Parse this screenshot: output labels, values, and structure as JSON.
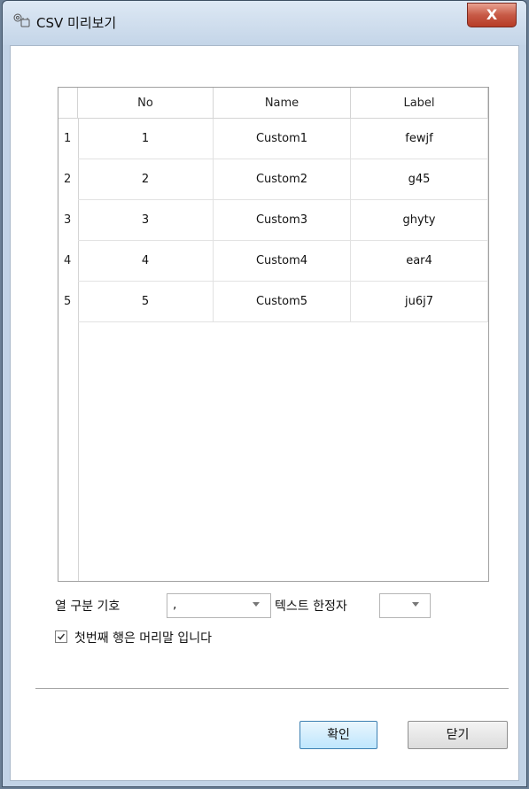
{
  "window": {
    "title": "CSV 미리보기",
    "close_label": "X"
  },
  "grid": {
    "columns": [
      "No",
      "Name",
      "Label"
    ],
    "rows": [
      {
        "row_num": "1",
        "no": "1",
        "name": "Custom1",
        "label": "fewjf"
      },
      {
        "row_num": "2",
        "no": "2",
        "name": "Custom2",
        "label": "g45"
      },
      {
        "row_num": "3",
        "no": "3",
        "name": "Custom3",
        "label": "ghyty"
      },
      {
        "row_num": "4",
        "no": "4",
        "name": "Custom4",
        "label": "ear4"
      },
      {
        "row_num": "5",
        "no": "5",
        "name": "Custom5",
        "label": "ju6j7"
      }
    ]
  },
  "options": {
    "delimiter_label": "열 구분 기호",
    "delimiter_value": ",",
    "qualifier_label": "텍스트 한정자",
    "qualifier_value": "",
    "header_checkbox_label": "첫번째 행은 머리말 입니다",
    "header_checked": true
  },
  "buttons": {
    "ok_label": "확인",
    "close_label": "닫기"
  },
  "colors": {
    "accent": "#bee6fd",
    "close": "#c75a46"
  }
}
